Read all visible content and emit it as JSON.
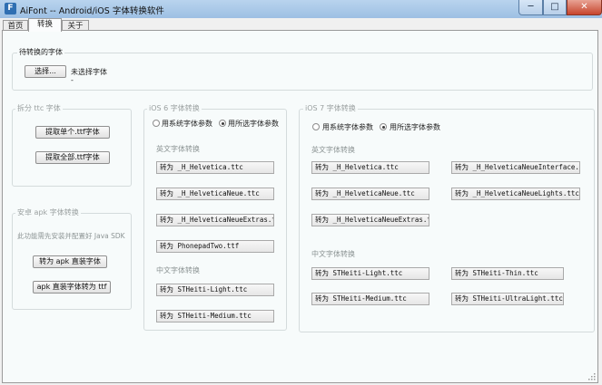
{
  "window": {
    "title": "AiFont -- Android/iOS 字体转换软件",
    "app_icon_glyph": "F",
    "min_glyph": "─",
    "max_glyph": "□",
    "close_glyph": "✕"
  },
  "tabs": [
    "首页",
    "转换",
    "关于"
  ],
  "source": {
    "group_label": "待转换的字体",
    "select_button": "选择...",
    "status": "未选择字体",
    "status_sub": "-"
  },
  "ttc": {
    "label": "拆分 ttc 字体",
    "extract_one": "提取单个.ttf字体",
    "extract_all": "提取全部.ttf字体"
  },
  "apk": {
    "label": "安卓 apk 字体转换",
    "note": "此功能需先安装并配置好 Java SDK",
    "to_apk": "转为 apk 直装字体",
    "apk_to_ttf": "apk 直装字体转为 ttf"
  },
  "ios6": {
    "label": "iOS 6 字体转换",
    "radio_system": "用系统字体参数",
    "radio_selected": "用所选字体参数",
    "english_label": "英文字体转换",
    "english": [
      "转为 _H_Helvetica.ttc",
      "转为 _H_HelveticaNeue.ttc",
      "转为 _H_HelveticaNeueExtras.ttc",
      "转为 PhonepadTwo.ttf"
    ],
    "chinese_label": "中文字体转换",
    "chinese": [
      "转为 STHeiti-Light.ttc",
      "转为 STHeiti-Medium.ttc"
    ]
  },
  "ios7": {
    "label": "iOS 7 字体转换",
    "radio_system": "用系统字体参数",
    "radio_selected": "用所选字体参数",
    "english_label": "英文字体转换",
    "english_left": [
      "转为 _H_Helvetica.ttc",
      "转为 _H_HelveticaNeue.ttc",
      "转为 _H_HelveticaNeueExtras.ttc"
    ],
    "english_right": [
      "转为 _H_HelveticaNeueInterface.ttc",
      "转为 _H_HelveticaNeueLights.ttc"
    ],
    "chinese_label": "中文字体转换",
    "chinese_left": [
      "转为 STHeiti-Light.ttc",
      "转为 STHeiti-Medium.ttc"
    ],
    "chinese_right": [
      "转为 STHeiti-Thin.ttc",
      "转为 STHeiti-UltraLight.ttc"
    ]
  }
}
